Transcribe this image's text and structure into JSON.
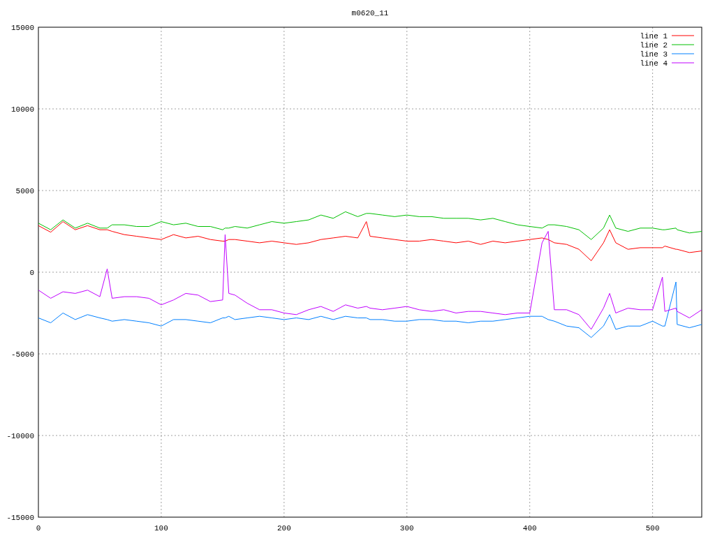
{
  "chart_data": {
    "type": "line",
    "title": "m0620_11",
    "grid": true,
    "legend": true,
    "xlim": [
      0,
      540
    ],
    "ylim": [
      -15000,
      15000
    ],
    "xticks": [
      0,
      100,
      200,
      300,
      400,
      500
    ],
    "yticks": [
      -15000,
      -10000,
      -5000,
      0,
      5000,
      10000,
      15000
    ],
    "x": [
      0,
      10,
      20,
      30,
      40,
      50,
      56,
      60,
      70,
      80,
      90,
      100,
      110,
      120,
      130,
      140,
      150,
      152,
      155,
      160,
      170,
      180,
      190,
      200,
      210,
      220,
      230,
      240,
      250,
      260,
      267,
      270,
      280,
      290,
      300,
      310,
      320,
      330,
      340,
      350,
      360,
      370,
      380,
      390,
      400,
      410,
      415,
      420,
      430,
      440,
      450,
      460,
      465,
      470,
      480,
      490,
      500,
      508,
      510,
      519,
      520,
      530,
      540
    ],
    "series": [
      {
        "name": "line 1",
        "color": "#ff0000",
        "values": [
          2850,
          2450,
          3100,
          2600,
          2850,
          2600,
          2600,
          2500,
          2300,
          2200,
          2100,
          2000,
          2300,
          2100,
          2200,
          2000,
          1900,
          1900,
          2000,
          2000,
          1900,
          1800,
          1900,
          1800,
          1700,
          1800,
          2000,
          2100,
          2200,
          2100,
          3100,
          2200,
          2100,
          2000,
          1900,
          1900,
          2000,
          1900,
          1800,
          1900,
          1700,
          1900,
          1800,
          1900,
          2000,
          2100,
          2000,
          1800,
          1700,
          1400,
          700,
          1800,
          2600,
          1800,
          1400,
          1500,
          1500,
          1500,
          1600,
          1400,
          1400,
          1200,
          1300
        ]
      },
      {
        "name": "line 2",
        "color": "#00c000",
        "values": [
          3000,
          2600,
          3200,
          2700,
          3000,
          2700,
          2700,
          2900,
          2900,
          2800,
          2800,
          3100,
          2900,
          3000,
          2800,
          2800,
          2600,
          2700,
          2700,
          2800,
          2700,
          2900,
          3100,
          3000,
          3100,
          3200,
          3500,
          3300,
          3700,
          3400,
          3600,
          3600,
          3500,
          3400,
          3500,
          3400,
          3400,
          3300,
          3300,
          3300,
          3200,
          3300,
          3100,
          2900,
          2800,
          2700,
          2900,
          2900,
          2800,
          2600,
          2000,
          2700,
          3500,
          2700,
          2500,
          2700,
          2700,
          2600,
          2600,
          2700,
          2600,
          2400,
          2500
        ]
      },
      {
        "name": "line 3",
        "color": "#0080ff",
        "values": [
          -2800,
          -3100,
          -2500,
          -2900,
          -2600,
          -2800,
          -2900,
          -3000,
          -2900,
          -3000,
          -3100,
          -3300,
          -2900,
          -2900,
          -3000,
          -3100,
          -2800,
          -2800,
          -2700,
          -2900,
          -2800,
          -2700,
          -2800,
          -2900,
          -2800,
          -2900,
          -2700,
          -2900,
          -2700,
          -2800,
          -2800,
          -2900,
          -2900,
          -3000,
          -3000,
          -2900,
          -2900,
          -3000,
          -3000,
          -3100,
          -3000,
          -3000,
          -2900,
          -2800,
          -2700,
          -2700,
          -2900,
          -3000,
          -3300,
          -3400,
          -4000,
          -3300,
          -2600,
          -3500,
          -3300,
          -3300,
          -3000,
          -3300,
          -3300,
          -600,
          -3200,
          -3400,
          -3200
        ]
      },
      {
        "name": "line 4",
        "color": "#c000ff",
        "values": [
          -1100,
          -1600,
          -1200,
          -1300,
          -1100,
          -1500,
          200,
          -1600,
          -1500,
          -1500,
          -1600,
          -2000,
          -1700,
          -1300,
          -1400,
          -1800,
          -1700,
          2300,
          -1300,
          -1400,
          -1900,
          -2300,
          -2300,
          -2500,
          -2600,
          -2300,
          -2100,
          -2400,
          -2000,
          -2200,
          -2100,
          -2200,
          -2300,
          -2200,
          -2100,
          -2300,
          -2400,
          -2300,
          -2500,
          -2400,
          -2400,
          -2500,
          -2600,
          -2500,
          -2500,
          1800,
          2500,
          -2300,
          -2300,
          -2600,
          -3500,
          -2200,
          -1300,
          -2500,
          -2200,
          -2300,
          -2300,
          -300,
          -2400,
          -2200,
          -2400,
          -2800,
          -2300
        ]
      }
    ]
  }
}
